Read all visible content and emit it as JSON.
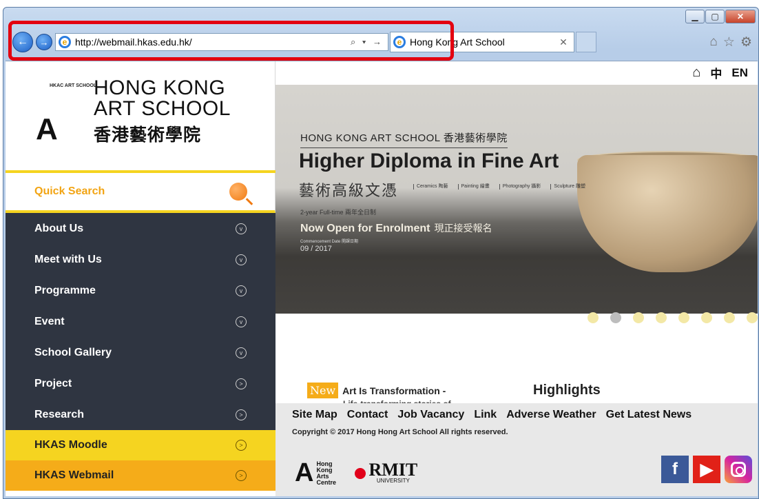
{
  "browser": {
    "url": "http://webmail.hkas.edu.hk/",
    "tab_title": "Hong Kong Art School",
    "address_tools": "⌕ ▾ →",
    "window_controls": [
      "minimize",
      "maximize",
      "close"
    ],
    "toolbar_icons": [
      "home-icon",
      "favorites-star-icon",
      "settings-gear-icon"
    ],
    "highlight_color": "#e3000f"
  },
  "header": {
    "logo_small": "HKAC ART SCHOOL",
    "logo_name_line1": "HONG KONG",
    "logo_name_line2": "ART SCHOOL",
    "logo_chinese": "香港藝術學院",
    "lang_zh": "中",
    "lang_en": "EN"
  },
  "sidebar": {
    "quick_search": "Quick Search",
    "items": [
      {
        "label": "About Us"
      },
      {
        "label": "Meet with Us"
      },
      {
        "label": "Programme"
      },
      {
        "label": "Event"
      },
      {
        "label": "School Gallery"
      },
      {
        "label": "Project"
      },
      {
        "label": "Research"
      }
    ],
    "moodle": "HKAS Moodle",
    "webmail": "HKAS Webmail",
    "accent_yellow": "#f5d420",
    "accent_orange": "#f5ac19",
    "menu_bg": "#2f3541"
  },
  "banner": {
    "subtitle": "HONG KONG ART SCHOOL 香港藝術學院",
    "title": "Higher Diploma in Fine Art",
    "title_cn": "藝術高級文憑",
    "disciplines": [
      "Ceramics 陶藝",
      "Painting 繪畫",
      "Photography 攝影",
      "Sculpture 雕塑"
    ],
    "duration": "2-year Full-time 兩年全日制",
    "enrol": "Now Open for Enrolment",
    "enrol_cn": "現正接受報名",
    "commencement": "Commencement Date 開課日期",
    "date": "09 / 2017",
    "slides": 8,
    "active_slide": 2
  },
  "news": {
    "badge": "New",
    "title": "Art Is Transformation -",
    "subtitle": "Life-transforming stories of",
    "highlights": "Highlights"
  },
  "footer": {
    "links": [
      "Site Map",
      "Contact",
      "Job Vacancy",
      "Link",
      "Adverse Weather",
      "Get Latest News"
    ],
    "copyright": "Copyright © 2017 Hong Hong Art School All rights reserved.",
    "hkac": "Hong Kong Arts Centre",
    "rmit": "RMIT",
    "rmit_sub": "UNIVERSITY"
  }
}
